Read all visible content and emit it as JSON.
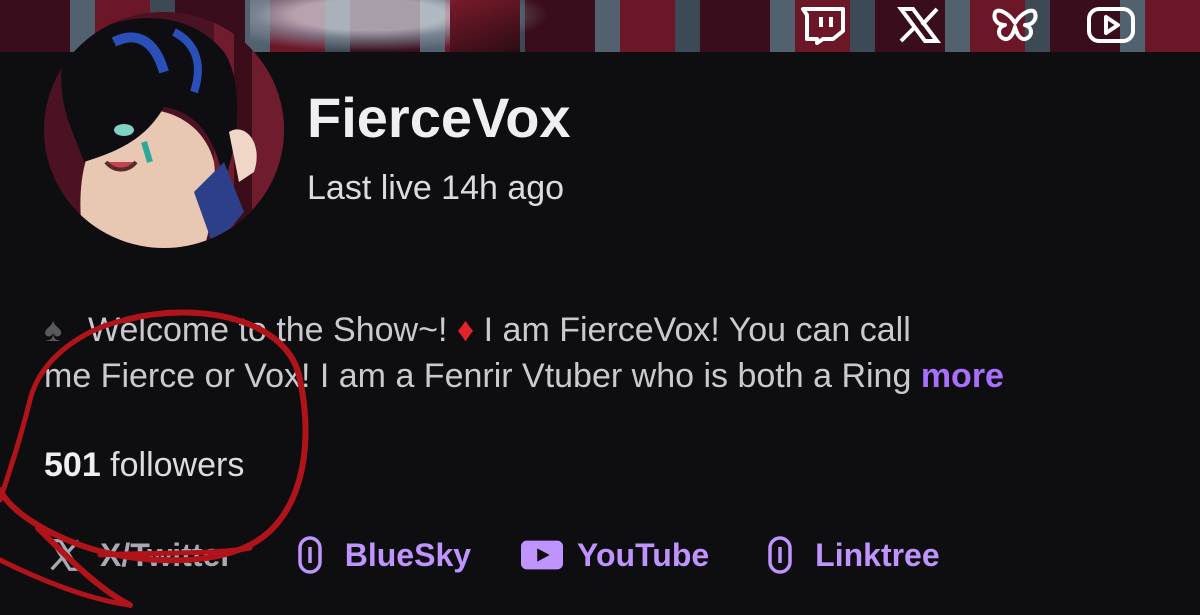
{
  "banner": {
    "social_icons": [
      "twitch-icon",
      "x-icon",
      "bluesky-butterfly-icon",
      "youtube-icon"
    ]
  },
  "profile": {
    "name": "FierceVox",
    "last_live": "Last live 14h ago"
  },
  "bio": {
    "line1_part1": "Welcome to the Show~! ",
    "line1_part2": " I am FierceVox! You can call",
    "line2": "me Fierce or Vox! I am a Fenrir Vtuber who is both a Ring",
    "more_label": "more",
    "spade_glyph": "♠",
    "diamond_glyph": "♦"
  },
  "followers": {
    "count": "501",
    "label": " followers"
  },
  "links": [
    {
      "label": "X/Twitter",
      "icon": "x-icon"
    },
    {
      "label": "BlueSky",
      "icon": "link-icon"
    },
    {
      "label": "YouTube",
      "icon": "youtube-icon"
    },
    {
      "label": "Linktree",
      "icon": "link-icon"
    }
  ],
  "colors": {
    "background": "#0e0e10",
    "accent_purple": "#bf94ff",
    "more_purple": "#a970ff",
    "annotation_red": "#b0141a",
    "diamond_red": "#e3242b"
  }
}
